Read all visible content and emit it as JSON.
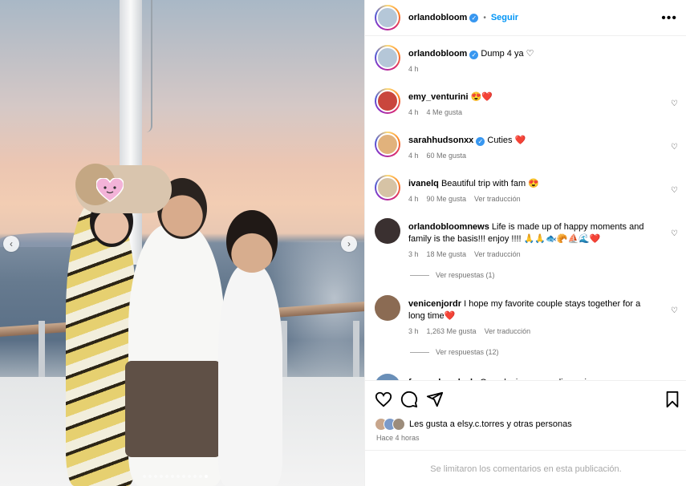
{
  "post": {
    "author": "orlandobloom",
    "follow_label": "Seguir",
    "more_glyph": "•••",
    "verified_glyph": "✓"
  },
  "media": {
    "prev_glyph": "‹",
    "next_glyph": "›",
    "slide_count": 12,
    "active_slide": 11
  },
  "comments": [
    {
      "user": "orlandobloom",
      "verified": true,
      "text": "Dump 4 ya ♡",
      "time": "4 h",
      "likes": "",
      "translate": ""
    },
    {
      "user": "emy_venturini",
      "verified": false,
      "text": "😍❤️",
      "time": "4 h",
      "likes": "4 Me gusta",
      "translate": ""
    },
    {
      "user": "sarahhudsonxx",
      "verified": true,
      "text": "Cuties ❤️",
      "time": "4 h",
      "likes": "60 Me gusta",
      "translate": ""
    },
    {
      "user": "ivanelq",
      "verified": false,
      "text": "Beautiful trip with fam 😍",
      "time": "4 h",
      "likes": "90 Me gusta",
      "translate": "Ver traducción"
    },
    {
      "user": "orlandobloomnews",
      "verified": false,
      "text": "Life is made up of happy moments and family is the basis!!! enjoy !!!! 🙏🙏🐟🥐⛵🌊❤️",
      "time": "3 h",
      "likes": "18 Me gusta",
      "translate": "Ver traducción",
      "replies": "Ver respuestas (1)"
    },
    {
      "user": "venicenjordr",
      "verified": false,
      "text": "I hope my favorite couple stays together for a long time❤️",
      "time": "3 h",
      "likes": "1,263 Me gusta",
      "translate": "Ver traducción",
      "replies": "Ver respuestas (12)"
    },
    {
      "user": "fernanda.valnzla",
      "verified": false,
      "text": "Que alguien me explique si regresaron o solo"
    }
  ],
  "footer": {
    "likes_text": "Les gusta a elsy.c.torres y otras personas",
    "time_ago": "Hace 4 horas",
    "limited_text": "Se limitaron los comentarios en esta publicación."
  },
  "icons": {
    "like": "heart-icon",
    "comment": "comment-icon",
    "share": "send-icon",
    "save": "bookmark-icon"
  },
  "colors": {
    "accent": "#0095f6",
    "verified": "#3897f0",
    "muted": "#737373"
  }
}
